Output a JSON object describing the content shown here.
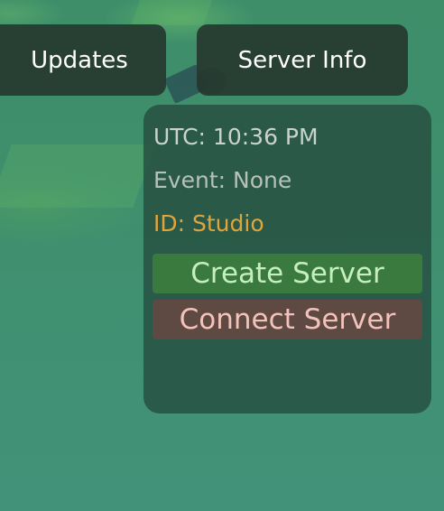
{
  "top_bar": {
    "updates_label": "Updates",
    "server_info_label": "Server Info"
  },
  "info_panel": {
    "utc": "UTC: 10:36 PM",
    "event": "Event: None",
    "id": "ID: Studio",
    "create_server_label": "Create Server",
    "connect_server_label": "Connect Server"
  },
  "colors": {
    "id_text": "#e0a53a",
    "create_button": "#3b7a3e",
    "connect_button": "#5e4a42"
  }
}
